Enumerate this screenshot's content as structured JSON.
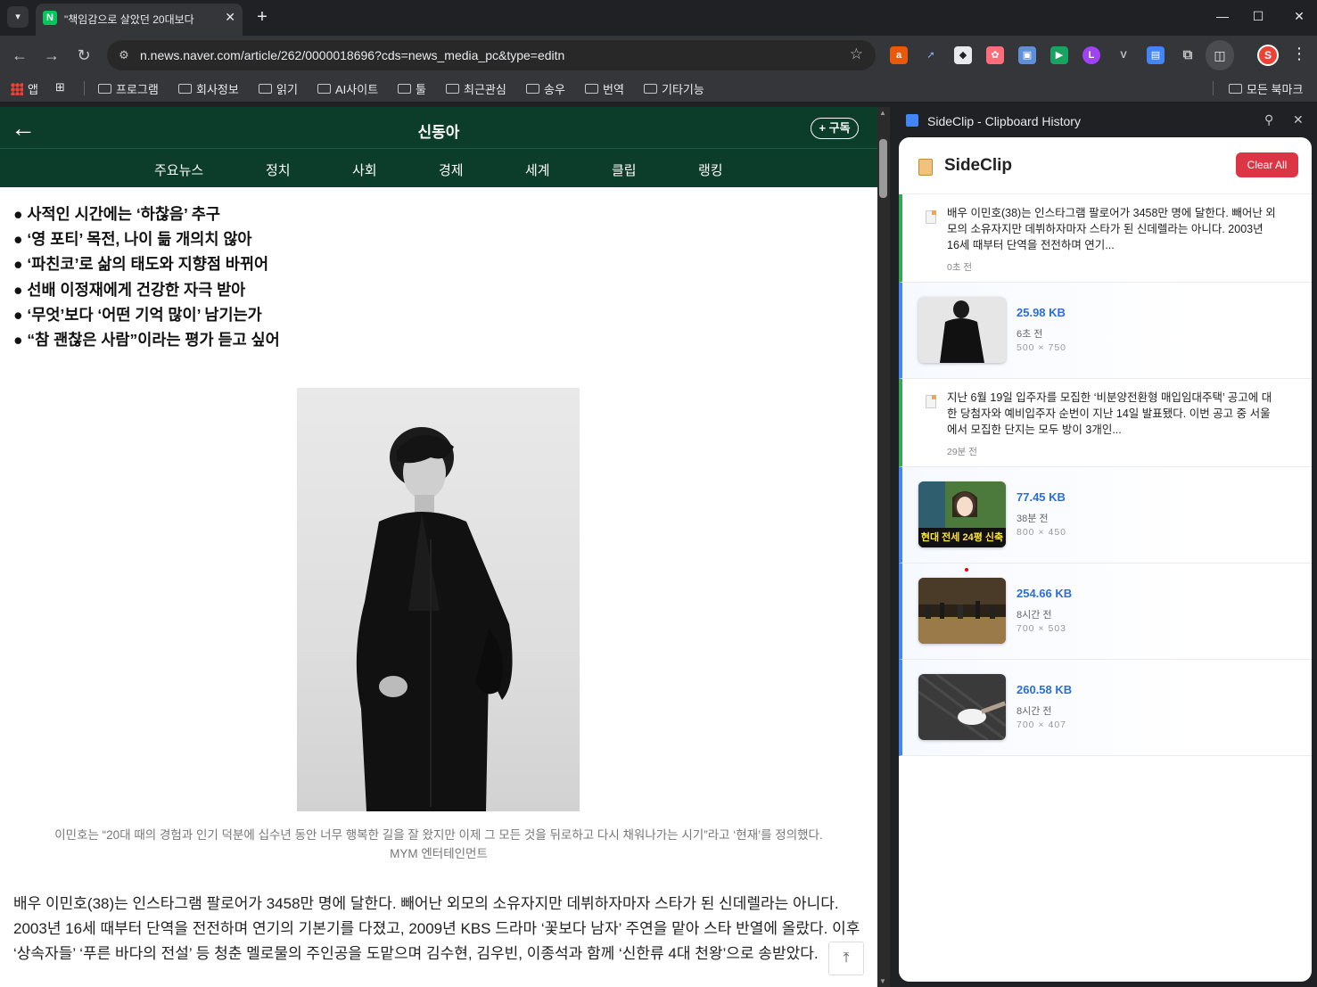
{
  "browser": {
    "tab_title": "\"책임감으로 살았던 20대보다",
    "url": "n.news.naver.com/article/262/0000018696?cds=news_media_pc&type=editn",
    "favicon_letter": "N",
    "profile_letter": "S",
    "bookmarks": [
      "앱",
      "프로그램",
      "회사정보",
      "읽기",
      "AI사이트",
      "툴",
      "최근관심",
      "송우",
      "번역",
      "기타기능",
      "모든 북마크"
    ]
  },
  "page": {
    "publication": "신동아",
    "subscribe_label": "+ 구독",
    "nav_tabs": [
      "주요뉴스",
      "정치",
      "사회",
      "경제",
      "세계",
      "클립",
      "랭킹"
    ],
    "highlights": [
      "● 사적인 시간에는 ‘하찮음’ 추구",
      "● ‘영 포티’ 목전, 나이 듦 개의치 않아",
      "● ‘파친코’로 삶의 태도와 지향점 바뀌어",
      "● 선배 이정재에게 건강한 자극 받아",
      "● ‘무엇’보다 ‘어떤 기억 많이’ 남기는가",
      "● “참 괜찮은 사람”이라는 평가 듣고 싶어"
    ],
    "caption_line1": "이민호는 “20대 때의 경험과 인기 덕분에 십수년 동안 너무 행복한 길을 잘 왔지만 이제 그 모든 것을 뒤로하고 다시 채워나가는 시기”라고 ‘현재’를 정의했다.",
    "caption_line2": "MYM 엔터테인먼트",
    "body": "배우 이민호(38)는 인스타그램 팔로어가 3458만 명에 달한다. 빼어난 외모의 소유자지만 데뷔하자마자 스타가 된 신데렐라는 아니다. 2003년 16세 때부터 단역을 전전하며 연기의 기본기를 다졌고, 2009년 KBS 드라마 ‘꽃보다 남자’ 주연을 맡아 스타 반열에 올랐다. 이후 ‘상속자들’ ‘푸른 바다의 전설’ 등 청춘 멜로물의 주인공을 도맡으며 김수현, 김우빈, 이종석과 함께 ‘신한류 4대 천왕’으로 송받았다."
  },
  "sidepanel": {
    "header_title": "SideClip - Clipboard History",
    "app_title": "SideClip",
    "clear_all": "Clear All",
    "items": [
      {
        "type": "text",
        "text": "배우 이민호(38)는 인스타그램 팔로어가 3458만 명에 달한다. 빼어난 외모의 소유자지만 데뷔하자마자 스타가 된 신데렐라는 아니다. 2003년 16세 때부터 단역을 전전하며 연기...",
        "time": "0초 전"
      },
      {
        "type": "image",
        "size": "25.98 KB",
        "time": "6초 전",
        "dims": "500 × 750"
      },
      {
        "type": "text",
        "text": "지난 6월 19일 입주자를 모집한 ‘비분양전환형 매입임대주택’ 공고에 대한 당첨자와 예비입주자 순번이 지난 14일 발표됐다. 이번 공고 중 서울에서 모집한 단지는 모두 방이 3개인...",
        "time": "29분 전"
      },
      {
        "type": "image",
        "size": "77.45 KB",
        "time": "38분 전",
        "dims": "800 × 450",
        "thumb_text": "현대 전세 24평 신축"
      },
      {
        "type": "image",
        "size": "254.66 KB",
        "time": "8시간 전",
        "dims": "700 × 503"
      },
      {
        "type": "image",
        "size": "260.58 KB",
        "time": "8시간 전",
        "dims": "700 × 407"
      }
    ]
  },
  "colors": {
    "accent_green": "#0b3d2a",
    "clear_red": "#dc3545",
    "size_blue": "#2b6fd6"
  }
}
